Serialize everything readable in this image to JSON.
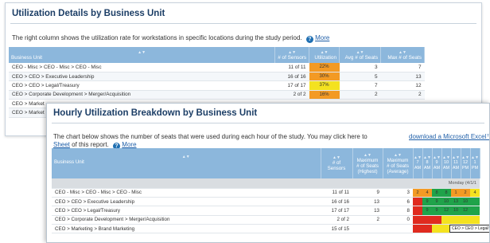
{
  "colors": {
    "header_blue": "#8cb7dc",
    "title_navy": "#1c3e66",
    "orange": "#f39a24",
    "yellow": "#f4e21f",
    "green": "#1fa34a",
    "red": "#e02b1f"
  },
  "utilization_panel": {
    "title": "Utilization Details by Business Unit",
    "description": "The right column shows the utilization rate for workstations in specific locations during the study period.",
    "more_link": "More",
    "columns": [
      "Business Unit",
      "# of Sensors",
      "Utilization",
      "Avg # of Seats",
      "Max # of Seats"
    ],
    "rows": [
      {
        "unit": "CEO - Misc > CEO - Misc > CEO - Misc",
        "sensors": "11 of 11",
        "utilization": "22%",
        "avg": "3",
        "max": "7",
        "color": "#f39a24"
      },
      {
        "unit": "CEO > CEO > Executive Leadership",
        "sensors": "16 of 16",
        "utilization": "30%",
        "avg": "5",
        "max": "13",
        "color": "#f39a24"
      },
      {
        "unit": "CEO > CEO > Legal/Treasury",
        "sensors": "17 of 17",
        "utilization": "37%",
        "avg": "7",
        "max": "12",
        "color": "#f4e21f"
      },
      {
        "unit": "CEO > Corporate Development > Merger/Acquisition",
        "sensors": "2 of 2",
        "utilization": "16%",
        "avg": "2",
        "max": "2",
        "color": "#f39a24"
      },
      {
        "unit": "CEO > Market",
        "sensors": "",
        "utilization": "",
        "avg": "",
        "max": "",
        "color": ""
      },
      {
        "unit": "CEO > Market",
        "sensors": "",
        "utilization": "",
        "avg": "",
        "max": "",
        "color": ""
      }
    ]
  },
  "hourly_panel": {
    "title": "Hourly Utilization Breakdown by Business Unit",
    "description_line1": "The chart below shows the number of seats that were used during each hour of the study. You may click here to",
    "download_link": "download a Microsoft Excel™",
    "description_line2_link": "Sheet",
    "description_line2_rest": "of this report.",
    "more_link": "More",
    "columns": {
      "unit": "Business Unit",
      "sensors_l1": "# of",
      "sensors_l2": "Sensors",
      "max_l1": "Maximum",
      "max_l2": "# of Seats",
      "max_l3": "(Highest)",
      "maxavg_l1": "Maximum",
      "maxavg_l2": "# of Seats",
      "maxavg_l3": "(Average)"
    },
    "hours": [
      {
        "h": "7",
        "p": "AM"
      },
      {
        "h": "8",
        "p": "AM"
      },
      {
        "h": "9",
        "p": "AM"
      },
      {
        "h": "10",
        "p": "AM"
      },
      {
        "h": "11",
        "p": "AM"
      },
      {
        "h": "12",
        "p": "PM"
      },
      {
        "h": "1",
        "p": "PM"
      }
    ],
    "group_label": "Monday (4/1/1",
    "rows": [
      {
        "unit": "CEO - Misc > CEO - Misc > CEO - Misc",
        "sensors": "11 of 11",
        "max": "9",
        "avg": "3",
        "cells": [
          {
            "v": "2",
            "c": "#f39a24"
          },
          {
            "v": "4",
            "c": "#f39a24"
          },
          {
            "v": "8",
            "c": "#1fa34a"
          },
          {
            "v": "8",
            "c": "#1fa34a"
          },
          {
            "v": "1",
            "c": "#f39a24"
          },
          {
            "v": "2",
            "c": "#f39a24"
          },
          {
            "v": "4",
            "c": "#f4e21f"
          }
        ]
      },
      {
        "unit": "CEO > CEO > Executive Leadership",
        "sensors": "16 of 16",
        "max": "13",
        "avg": "6",
        "cells": [
          {
            "v": "",
            "c": "#e02b1f"
          },
          {
            "v": "9",
            "c": "#1fa34a"
          },
          {
            "v": "9",
            "c": "#1fa34a"
          },
          {
            "v": "10",
            "c": "#1fa34a"
          },
          {
            "v": "13",
            "c": "#1fa34a"
          },
          {
            "v": "10",
            "c": "#1fa34a"
          },
          {
            "v": "",
            "c": "#1fa34a"
          }
        ]
      },
      {
        "unit": "CEO > CEO > Legal/Treasury",
        "sensors": "17 of 17",
        "max": "13",
        "avg": "8",
        "cells": [
          {
            "v": "",
            "c": "#e02b1f"
          },
          {
            "v": "9",
            "c": "#1fa34a"
          },
          {
            "v": "9",
            "c": "#1fa34a"
          },
          {
            "v": "12",
            "c": "#1fa34a"
          },
          {
            "v": "10",
            "c": "#1fa34a"
          },
          {
            "v": "12",
            "c": "#1fa34a"
          },
          {
            "v": "",
            "c": "#1fa34a"
          }
        ]
      },
      {
        "unit": "CEO > Corporate Development > Merger/Acquisition",
        "sensors": "2 of 2",
        "max": "2",
        "avg": "0",
        "cells": [
          {
            "v": "",
            "c": "#e02b1f"
          },
          {
            "v": "",
            "c": "#e02b1f"
          },
          {
            "v": "",
            "c": "#e02b1f"
          },
          {
            "v": "",
            "c": "#f4e21f"
          },
          {
            "v": "",
            "c": "#f4e21f"
          },
          {
            "v": "",
            "c": "#f4e21f"
          },
          {
            "v": "",
            "c": "#f4e21f"
          }
        ]
      },
      {
        "unit": "CEO > Marketing > Brand Marketing",
        "sensors": "15 of 15",
        "max": "",
        "avg": "",
        "cells": [
          {
            "v": "",
            "c": "#e02b1f"
          },
          {
            "v": "",
            "c": "#e02b1f"
          },
          {
            "v": "",
            "c": "#f4e21f"
          },
          {
            "v": "",
            "c": "#f4e21f"
          },
          {
            "v": "",
            "c": "#f4e21f"
          },
          {
            "v": "",
            "c": "#f4e21f"
          },
          {
            "v": "",
            "c": "#f4e21f"
          }
        ]
      }
    ],
    "tooltip": "CEO > CEO > Legal/Tre"
  }
}
